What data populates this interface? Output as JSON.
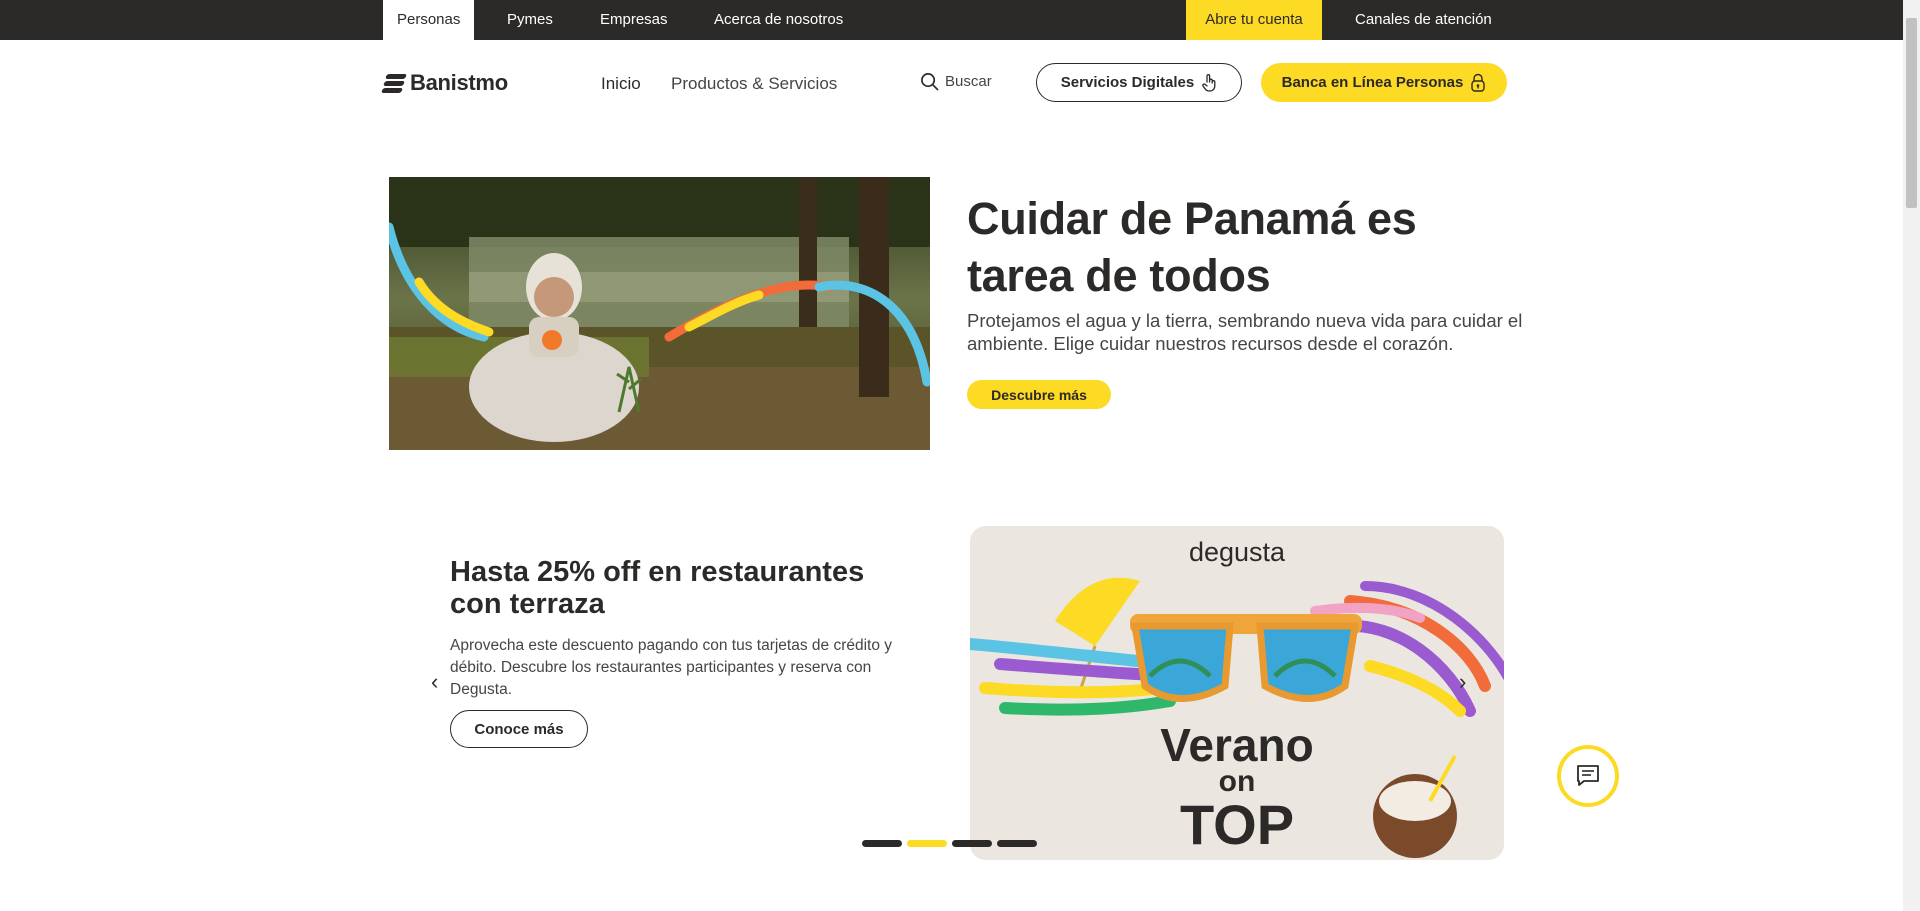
{
  "topbar": {
    "items": [
      {
        "label": "Personas"
      },
      {
        "label": "Pymes"
      },
      {
        "label": "Empresas"
      },
      {
        "label": "Acerca de nosotros"
      }
    ],
    "cta": "Abre tu cuenta",
    "channels": "Canales de atención"
  },
  "header": {
    "logo": "Banistmo",
    "nav": [
      {
        "label": "Inicio"
      },
      {
        "label": "Productos & Servicios"
      }
    ],
    "search": "Buscar",
    "digital_button": "Servicios Digitales",
    "online_button": "Banca en Línea Personas"
  },
  "hero": {
    "title": "Cuidar de Panamá es tarea de todos",
    "text": "Protejamos el agua y la tierra, sembrando nueva vida para cuidar el ambiente. Elige cuidar nuestros recursos desde el corazón.",
    "button": "Descubre más"
  },
  "promo": {
    "title": "Hasta 25% off en restaurantes con terraza",
    "text": "Aprovecha este descuento pagando con tus tarjetas de crédito y débito. Descubre los restaurantes participantes y reserva con Degusta.",
    "button": "Conoce más",
    "image": {
      "brand": "degusta",
      "line1": "Verano",
      "line2": "on",
      "line3": "TOP"
    },
    "prev_arrow": "‹",
    "next_arrow": "›"
  },
  "carousel": {
    "total": 4,
    "active": 2
  },
  "colors": {
    "brand_yellow": "#fdda24",
    "dark": "#2c2a29"
  }
}
